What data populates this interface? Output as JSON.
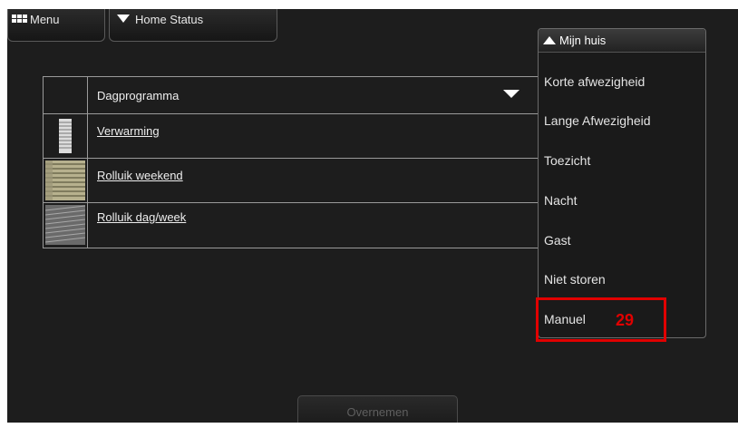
{
  "topbar": {
    "menu_label": "Menu",
    "home_status_label": "Home Status"
  },
  "table": {
    "header": "Dagprogramma",
    "rows": [
      {
        "label": "Verwarming",
        "icon": "radiator-icon"
      },
      {
        "label": "Rolluik weekend",
        "icon": "shutter-icon"
      },
      {
        "label": "Rolluik dag/week",
        "icon": "blinds-icon"
      }
    ]
  },
  "dropdown": {
    "header": "Mijn huis",
    "items": [
      "Korte afwezigheid",
      "Lange Afwezigheid",
      "Toezicht",
      "Nacht",
      "Gast",
      "Niet storen",
      "Manuel"
    ]
  },
  "annotation": {
    "badge": "29",
    "color": "#e10000"
  },
  "footer": {
    "apply_label": "Overnemen"
  }
}
